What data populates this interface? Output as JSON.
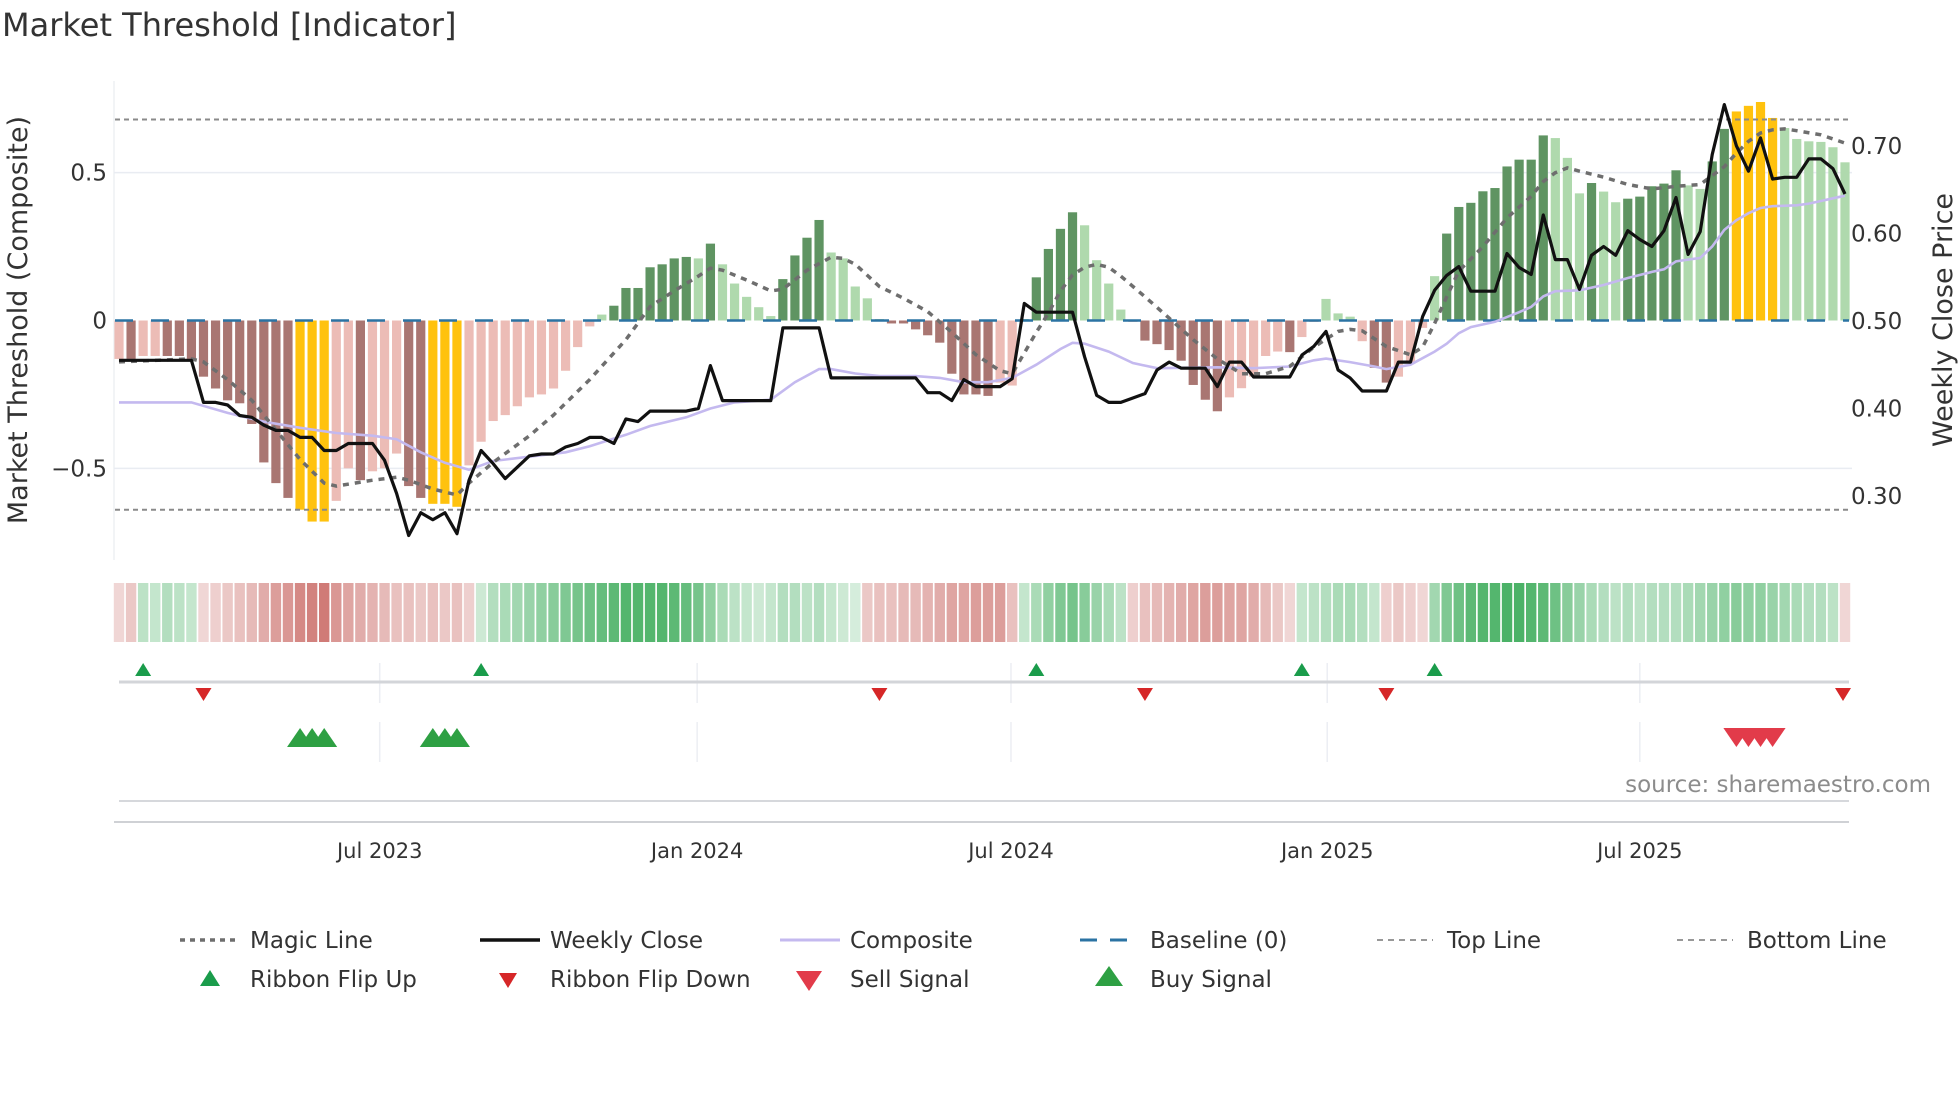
{
  "title": "Market Threshold [Indicator]",
  "source": "source: sharemaestro.com",
  "colors": {
    "dark_red": "#a97672",
    "light_red": "#ecbcb6",
    "dark_green": "#5f9462",
    "light_green": "#afd9ad",
    "extreme": "#ffc20e",
    "ribbon_red": "#c45a55",
    "ribbon_green": "#34a853",
    "magic": "#6e6e6e",
    "close": "#111111",
    "composite": "#c4b9ef",
    "baseline": "#2b73a3",
    "guide": "#8a8a8a",
    "flip_up": "#1a9c4b",
    "flip_down": "#d62728",
    "buy": "#2ea043",
    "sell": "#e23b4a"
  },
  "chart_data": {
    "type": "bar+line",
    "title": "Market Threshold [Indicator]",
    "ylabel_left": "Market Threshold (Composite)",
    "ylabel_right": "Weekly Close Price",
    "ylim_left": [
      -0.81,
      0.81
    ],
    "ylim_right": [
      0.227,
      0.774
    ],
    "yticks_left": [
      {
        "v": 0.5,
        "label": "0.5"
      },
      {
        "v": 0,
        "label": "0"
      },
      {
        "v": -0.5,
        "label": "−0.5"
      }
    ],
    "yticks_right": [
      {
        "v": 0.7,
        "label": "0.70"
      },
      {
        "v": 0.6,
        "label": "0.60"
      },
      {
        "v": 0.5,
        "label": "0.50"
      },
      {
        "v": 0.4,
        "label": "0.40"
      },
      {
        "v": 0.3,
        "label": "0.30"
      }
    ],
    "xticks": [
      {
        "week": 22.6,
        "label": "Jul 2023"
      },
      {
        "week": 48.9,
        "label": "Jan 2024"
      },
      {
        "week": 74.9,
        "label": "Jul 2024"
      },
      {
        "week": 101.1,
        "label": "Jan 2025"
      },
      {
        "week": 127.0,
        "label": "Jul 2025"
      }
    ],
    "top_line": 0.68,
    "bottom_line": -0.64,
    "baseline": 0,
    "composite_bars": [
      -0.13,
      -0.13,
      -0.12,
      -0.12,
      -0.12,
      -0.12,
      -0.13,
      -0.19,
      -0.23,
      -0.27,
      -0.28,
      -0.35,
      -0.48,
      -0.55,
      -0.6,
      -0.64,
      -0.68,
      -0.68,
      -0.61,
      -0.5,
      -0.54,
      -0.51,
      -0.5,
      -0.45,
      -0.56,
      -0.6,
      -0.62,
      -0.62,
      -0.63,
      -0.49,
      -0.41,
      -0.34,
      -0.32,
      -0.29,
      -0.26,
      -0.25,
      -0.23,
      -0.17,
      -0.09,
      -0.02,
      0.02,
      0.05,
      0.11,
      0.11,
      0.18,
      0.19,
      0.21,
      0.215,
      0.21,
      0.26,
      0.19,
      0.125,
      0.08,
      0.045,
      0.015,
      0.14,
      0.22,
      0.28,
      0.34,
      0.23,
      0.21,
      0.115,
      0.075,
      0.005,
      -0.01,
      -0.01,
      -0.03,
      -0.05,
      -0.075,
      -0.18,
      -0.25,
      -0.25,
      -0.255,
      -0.21,
      -0.22,
      0.005,
      0.146,
      0.242,
      0.31,
      0.366,
      0.322,
      0.204,
      0.125,
      0.037,
      -0.005,
      -0.068,
      -0.08,
      -0.1,
      -0.136,
      -0.218,
      -0.268,
      -0.307,
      -0.26,
      -0.229,
      -0.19,
      -0.12,
      -0.105,
      -0.107,
      -0.056,
      -0.005,
      0.073,
      0.024,
      0.013,
      -0.07,
      -0.16,
      -0.21,
      -0.19,
      -0.145,
      -0.025,
      0.15,
      0.294,
      0.384,
      0.398,
      0.437,
      0.448,
      0.521,
      0.544,
      0.544,
      0.626,
      0.617,
      0.55,
      0.43,
      0.465,
      0.436,
      0.4,
      0.412,
      0.419,
      0.454,
      0.463,
      0.508,
      0.457,
      0.445,
      0.538,
      0.648,
      0.707,
      0.726,
      0.739,
      0.685,
      0.651,
      0.614,
      0.606,
      0.604,
      0.586,
      0.535
    ],
    "bar_class": [
      "lr",
      "dr",
      "lr",
      "lr",
      "dr",
      "dr",
      "dr",
      "dr",
      "dr",
      "dr",
      "dr",
      "dr",
      "dr",
      "dr",
      "dr",
      "y",
      "y",
      "y",
      "lr",
      "lr",
      "dr",
      "lr",
      "lr",
      "lr",
      "dr",
      "dr",
      "y",
      "y",
      "y",
      "lr",
      "lr",
      "lr",
      "lr",
      "lr",
      "lr",
      "lr",
      "lr",
      "lr",
      "lr",
      "lr",
      "lg",
      "dg",
      "dg",
      "dg",
      "dg",
      "dg",
      "dg",
      "dg",
      "lg",
      "dg",
      "lg",
      "lg",
      "lg",
      "lg",
      "lg",
      "dg",
      "dg",
      "dg",
      "dg",
      "lg",
      "lg",
      "lg",
      "lg",
      "lg",
      "dr",
      "dr",
      "dr",
      "dr",
      "dr",
      "dr",
      "dr",
      "dr",
      "dr",
      "lr",
      "lr",
      "lg",
      "dg",
      "dg",
      "dg",
      "dg",
      "lg",
      "lg",
      "lg",
      "lg",
      "lr",
      "dr",
      "dr",
      "dr",
      "dr",
      "dr",
      "dr",
      "dr",
      "lr",
      "lr",
      "lr",
      "lr",
      "lr",
      "dr",
      "lr",
      "lr",
      "lg",
      "lg",
      "lg",
      "lr",
      "dr",
      "dr",
      "lr",
      "lr",
      "lr",
      "lg",
      "dg",
      "dg",
      "dg",
      "dg",
      "dg",
      "dg",
      "dg",
      "dg",
      "dg",
      "lg",
      "lg",
      "lg",
      "dg",
      "lg",
      "lg",
      "dg",
      "dg",
      "dg",
      "dg",
      "dg",
      "lg",
      "lg",
      "dg",
      "dg",
      "y",
      "y",
      "y",
      "y",
      "lg",
      "lg",
      "lg",
      "lg",
      "lg",
      "lg"
    ],
    "weekly_close": [
      0.455,
      0.455,
      0.455,
      0.455,
      0.455,
      0.455,
      0.455,
      0.407,
      0.407,
      0.404,
      0.392,
      0.39,
      0.381,
      0.375,
      0.375,
      0.367,
      0.367,
      0.352,
      0.352,
      0.36,
      0.36,
      0.36,
      0.341,
      0.303,
      0.255,
      0.281,
      0.273,
      0.281,
      0.257,
      0.318,
      0.352,
      0.337,
      0.32,
      0.333,
      0.346,
      0.348,
      0.348,
      0.356,
      0.36,
      0.367,
      0.367,
      0.36,
      0.388,
      0.385,
      0.397,
      0.397,
      0.397,
      0.397,
      0.4,
      0.449,
      0.409,
      0.409,
      0.409,
      0.409,
      0.409,
      0.492,
      0.492,
      0.492,
      0.492,
      0.435,
      0.435,
      0.435,
      0.435,
      0.435,
      0.435,
      0.435,
      0.435,
      0.418,
      0.418,
      0.409,
      0.433,
      0.425,
      0.425,
      0.425,
      0.434,
      0.52,
      0.51,
      0.51,
      0.51,
      0.51,
      0.459,
      0.415,
      0.407,
      0.407,
      0.412,
      0.417,
      0.444,
      0.453,
      0.446,
      0.446,
      0.446,
      0.425,
      0.453,
      0.453,
      0.436,
      0.436,
      0.436,
      0.436,
      0.461,
      0.471,
      0.488,
      0.444,
      0.435,
      0.42,
      0.42,
      0.42,
      0.453,
      0.453,
      0.505,
      0.535,
      0.552,
      0.562,
      0.534,
      0.534,
      0.534,
      0.577,
      0.561,
      0.553,
      0.621,
      0.57,
      0.57,
      0.536,
      0.575,
      0.585,
      0.575,
      0.603,
      0.593,
      0.585,
      0.603,
      0.641,
      0.576,
      0.602,
      0.69,
      0.747,
      0.7,
      0.671,
      0.709,
      0.662,
      0.664,
      0.664,
      0.685,
      0.685,
      0.674,
      0.645
    ],
    "composite_line": [
      [
        1,
        0.407
      ],
      [
        7,
        0.407
      ],
      [
        10,
        0.395
      ],
      [
        13,
        0.385
      ],
      [
        16,
        0.378
      ],
      [
        19,
        0.372
      ],
      [
        22,
        0.369
      ],
      [
        24,
        0.365
      ],
      [
        26,
        0.35
      ],
      [
        28,
        0.338
      ],
      [
        30,
        0.33
      ],
      [
        32,
        0.34
      ],
      [
        35,
        0.345
      ],
      [
        38,
        0.35
      ],
      [
        40,
        0.357
      ],
      [
        43,
        0.37
      ],
      [
        45,
        0.38
      ],
      [
        48,
        0.39
      ],
      [
        50,
        0.4
      ],
      [
        52,
        0.407
      ],
      [
        55,
        0.41
      ],
      [
        57,
        0.43
      ],
      [
        59,
        0.445
      ],
      [
        60,
        0.445
      ],
      [
        62,
        0.44
      ],
      [
        64,
        0.437
      ],
      [
        67,
        0.437
      ],
      [
        69,
        0.435
      ],
      [
        71,
        0.43
      ],
      [
        73,
        0.43
      ],
      [
        75,
        0.435
      ],
      [
        77,
        0.45
      ],
      [
        79,
        0.468
      ],
      [
        80,
        0.475
      ],
      [
        81,
        0.474
      ],
      [
        83,
        0.465
      ],
      [
        85,
        0.452
      ],
      [
        87,
        0.446
      ],
      [
        92,
        0.447
      ],
      [
        95,
        0.446
      ],
      [
        98,
        0.448
      ],
      [
        100,
        0.455
      ],
      [
        101,
        0.457
      ],
      [
        103,
        0.453
      ],
      [
        105,
        0.448
      ],
      [
        106,
        0.445
      ],
      [
        108,
        0.45
      ],
      [
        110,
        0.465
      ],
      [
        111,
        0.474
      ],
      [
        112,
        0.486
      ],
      [
        113,
        0.493
      ],
      [
        115,
        0.499
      ],
      [
        117,
        0.51
      ],
      [
        118,
        0.516
      ],
      [
        119,
        0.528
      ],
      [
        120,
        0.534
      ],
      [
        122,
        0.535
      ],
      [
        124,
        0.541
      ],
      [
        126,
        0.549
      ],
      [
        128,
        0.556
      ],
      [
        129,
        0.559
      ],
      [
        130,
        0.568
      ],
      [
        132,
        0.572
      ],
      [
        133,
        0.585
      ],
      [
        134,
        0.604
      ],
      [
        135,
        0.615
      ],
      [
        136,
        0.623
      ],
      [
        137,
        0.629
      ],
      [
        138,
        0.631
      ],
      [
        140,
        0.632
      ],
      [
        141,
        0.634
      ],
      [
        142,
        0.637
      ],
      [
        143,
        0.64
      ],
      [
        144,
        0.643
      ]
    ],
    "magic_line": [
      [
        1,
        -0.14
      ],
      [
        7,
        -0.13
      ],
      [
        8,
        -0.14
      ],
      [
        10,
        -0.2
      ],
      [
        12,
        -0.27
      ],
      [
        14,
        -0.37
      ],
      [
        16,
        -0.47
      ],
      [
        18,
        -0.55
      ],
      [
        19,
        -0.56
      ],
      [
        22,
        -0.54
      ],
      [
        24,
        -0.53
      ],
      [
        25,
        -0.54
      ],
      [
        27,
        -0.57
      ],
      [
        29,
        -0.59
      ],
      [
        30,
        -0.55
      ],
      [
        32,
        -0.48
      ],
      [
        35,
        -0.39
      ],
      [
        37,
        -0.32
      ],
      [
        40,
        -0.2
      ],
      [
        43,
        -0.065
      ],
      [
        45,
        0.047
      ],
      [
        47,
        0.1
      ],
      [
        49,
        0.15
      ],
      [
        50,
        0.177
      ],
      [
        51,
        0.17
      ],
      [
        53,
        0.137
      ],
      [
        55,
        0.1
      ],
      [
        56,
        0.106
      ],
      [
        58,
        0.17
      ],
      [
        60,
        0.214
      ],
      [
        61,
        0.21
      ],
      [
        62,
        0.19
      ],
      [
        64,
        0.115
      ],
      [
        66,
        0.075
      ],
      [
        68,
        0.03
      ],
      [
        70,
        -0.04
      ],
      [
        72,
        -0.116
      ],
      [
        74,
        -0.17
      ],
      [
        75,
        -0.18
      ],
      [
        76,
        -0.11
      ],
      [
        77,
        -0.04
      ],
      [
        78,
        0.025
      ],
      [
        79,
        0.1
      ],
      [
        80,
        0.154
      ],
      [
        81,
        0.18
      ],
      [
        82,
        0.19
      ],
      [
        83,
        0.18
      ],
      [
        84,
        0.15
      ],
      [
        86,
        0.08
      ],
      [
        88,
        0.008
      ],
      [
        90,
        -0.065
      ],
      [
        92,
        -0.13
      ],
      [
        94,
        -0.18
      ],
      [
        96,
        -0.18
      ],
      [
        98,
        -0.155
      ],
      [
        100,
        -0.09
      ],
      [
        102,
        -0.037
      ],
      [
        103,
        -0.03
      ],
      [
        104,
        -0.035
      ],
      [
        106,
        -0.088
      ],
      [
        108,
        -0.116
      ],
      [
        109,
        -0.09
      ],
      [
        110,
        -0.01
      ],
      [
        111,
        0.08
      ],
      [
        112,
        0.167
      ],
      [
        114,
        0.25
      ],
      [
        116,
        0.347
      ],
      [
        118,
        0.42
      ],
      [
        119,
        0.47
      ],
      [
        120,
        0.5
      ],
      [
        121,
        0.516
      ],
      [
        122,
        0.505
      ],
      [
        124,
        0.485
      ],
      [
        126,
        0.46
      ],
      [
        128,
        0.445
      ],
      [
        130,
        0.454
      ],
      [
        132,
        0.46
      ],
      [
        133,
        0.49
      ],
      [
        134,
        0.52
      ],
      [
        135,
        0.566
      ],
      [
        136,
        0.606
      ],
      [
        137,
        0.634
      ],
      [
        138,
        0.645
      ],
      [
        139,
        0.648
      ],
      [
        140,
        0.642
      ],
      [
        142,
        0.628
      ],
      [
        144,
        0.6
      ]
    ],
    "ribbon": [
      -0.15,
      -0.25,
      0.25,
      0.2,
      0.3,
      0.25,
      0.2,
      -0.15,
      -0.2,
      -0.25,
      -0.3,
      -0.35,
      -0.45,
      -0.55,
      -0.6,
      -0.7,
      -0.75,
      -0.8,
      -0.6,
      -0.5,
      -0.45,
      -0.4,
      -0.35,
      -0.3,
      -0.3,
      -0.25,
      -0.3,
      -0.25,
      -0.3,
      -0.2,
      0.15,
      0.3,
      0.35,
      0.4,
      0.45,
      0.5,
      0.55,
      0.6,
      0.65,
      0.7,
      0.75,
      0.8,
      0.85,
      0.85,
      0.85,
      0.85,
      0.8,
      0.75,
      0.65,
      0.5,
      0.35,
      0.25,
      0.2,
      0.15,
      0.2,
      0.3,
      0.3,
      0.25,
      0.3,
      0.2,
      0.15,
      0.1,
      -0.25,
      -0.3,
      -0.3,
      -0.35,
      -0.35,
      -0.4,
      -0.45,
      -0.5,
      -0.5,
      -0.55,
      -0.55,
      -0.55,
      -0.3,
      0.2,
      0.35,
      0.5,
      0.6,
      0.65,
      0.55,
      0.45,
      0.35,
      0.25,
      -0.2,
      -0.3,
      -0.35,
      -0.4,
      -0.45,
      -0.5,
      -0.55,
      -0.55,
      -0.5,
      -0.5,
      -0.45,
      -0.35,
      -0.25,
      -0.15,
      0.2,
      0.25,
      0.3,
      0.35,
      0.35,
      0.3,
      0.2,
      -0.2,
      -0.25,
      -0.2,
      -0.15,
      0.4,
      0.6,
      0.7,
      0.8,
      0.85,
      0.85,
      0.9,
      0.9,
      0.85,
      0.8,
      0.7,
      0.55,
      0.45,
      0.35,
      0.3,
      0.25,
      0.3,
      0.25,
      0.3,
      0.3,
      0.3,
      0.35,
      0.4,
      0.45,
      0.5,
      0.55,
      0.5,
      0.5,
      0.45,
      0.4,
      0.35,
      0.3,
      0.3,
      0.25,
      -0.15
    ],
    "ribbon_flip_up_weeks": [
      3,
      31,
      77,
      99,
      110
    ],
    "ribbon_flip_down_weeks": [
      8,
      64,
      86,
      106,
      144
    ],
    "buy_signal_weeks": [
      16,
      17,
      18,
      27,
      28,
      29
    ],
    "sell_signal_weeks": [
      135,
      136,
      137,
      138
    ],
    "legend": [
      {
        "key": "magic",
        "label": "Magic Line"
      },
      {
        "key": "close",
        "label": "Weekly Close"
      },
      {
        "key": "composite",
        "label": "Composite"
      },
      {
        "key": "baseline",
        "label": "Baseline (0)"
      },
      {
        "key": "top",
        "label": "Top Line"
      },
      {
        "key": "bottom",
        "label": "Bottom Line"
      },
      {
        "key": "flip_up",
        "label": "Ribbon Flip Up"
      },
      {
        "key": "flip_down",
        "label": "Ribbon Flip Down"
      },
      {
        "key": "sell",
        "label": "Sell Signal"
      },
      {
        "key": "buy",
        "label": "Buy Signal"
      }
    ]
  }
}
